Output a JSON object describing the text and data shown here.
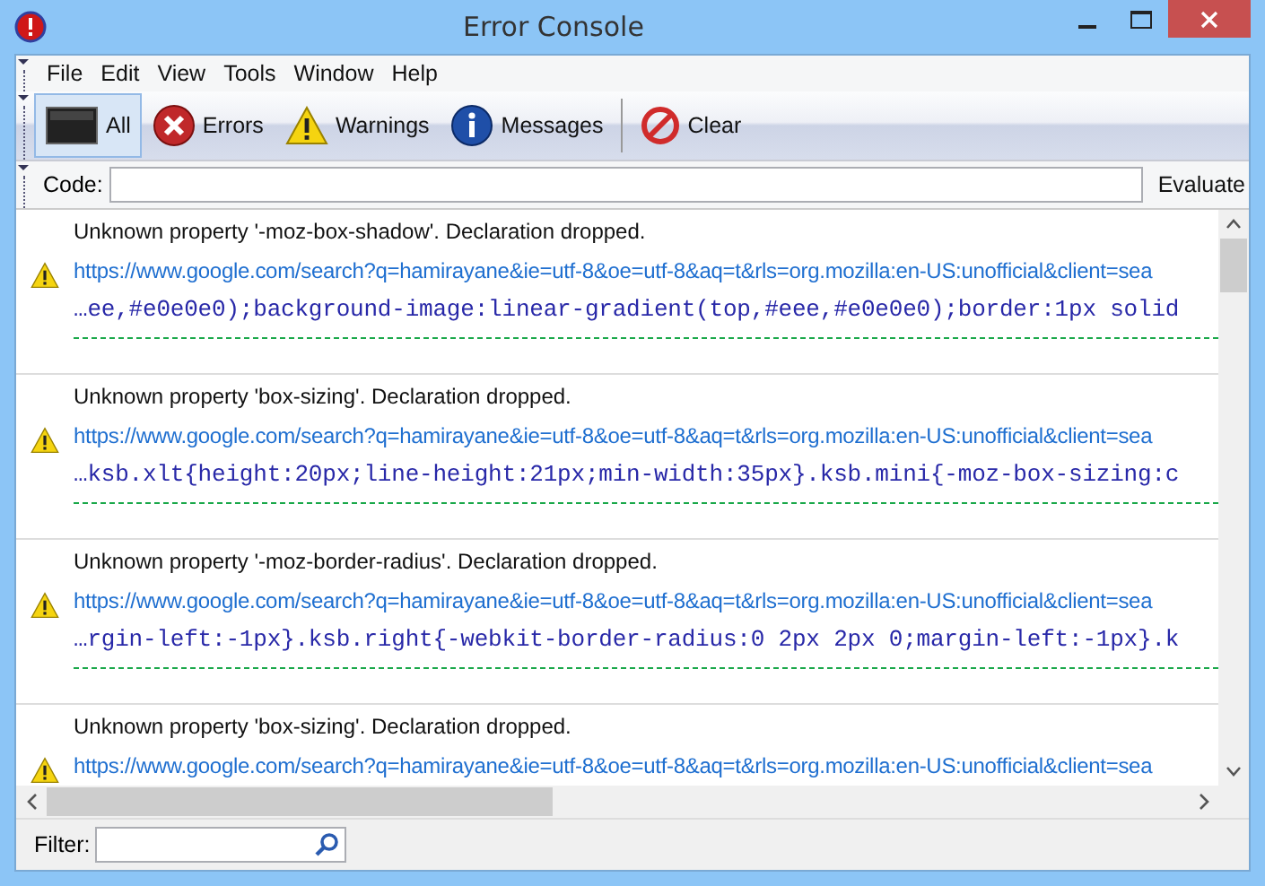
{
  "window": {
    "title": "Error Console"
  },
  "menu": [
    "File",
    "Edit",
    "View",
    "Tools",
    "Window",
    "Help"
  ],
  "toolbar": {
    "buttons": [
      {
        "label": "All",
        "kind": "all",
        "selected": true
      },
      {
        "label": "Errors",
        "kind": "error",
        "selected": false
      },
      {
        "label": "Warnings",
        "kind": "warning",
        "selected": false
      },
      {
        "label": "Messages",
        "kind": "message",
        "selected": false
      },
      {
        "label": "Clear",
        "kind": "clear",
        "selected": false
      }
    ]
  },
  "code_bar": {
    "label": "Code:",
    "button": "Evaluate"
  },
  "messages": [
    {
      "kind": "warning",
      "text": "Unknown property '-moz-box-shadow'.  Declaration dropped.",
      "url": "https://www.google.com/search?q=hamirayane&ie=utf-8&oe=utf-8&aq=t&rls=org.mozilla:en-US:unofficial&client=sea",
      "source": "…ee,#e0e0e0);background-image:linear-gradient(top,#eee,#e0e0e0);border:1px solid"
    },
    {
      "kind": "warning",
      "text": "Unknown property 'box-sizing'.  Declaration dropped.",
      "url": "https://www.google.com/search?q=hamirayane&ie=utf-8&oe=utf-8&aq=t&rls=org.mozilla:en-US:unofficial&client=sea",
      "source": "…ksb.xlt{height:20px;line-height:21px;min-width:35px}.ksb.mini{-moz-box-sizing:c"
    },
    {
      "kind": "warning",
      "text": "Unknown property '-moz-border-radius'.  Declaration dropped.",
      "url": "https://www.google.com/search?q=hamirayane&ie=utf-8&oe=utf-8&aq=t&rls=org.mozilla:en-US:unofficial&client=sea",
      "source": "…rgin-left:-1px}.ksb.right{-webkit-border-radius:0 2px 2px 0;margin-left:-1px}.k"
    },
    {
      "kind": "warning",
      "text": "Unknown property 'box-sizing'.  Declaration dropped.",
      "url": "https://www.google.com/search?q=hamirayane&ie=utf-8&oe=utf-8&aq=t&rls=org.mozilla:en-US:unofficial&client=sea"
    }
  ],
  "filter": {
    "label": "Filter:"
  }
}
